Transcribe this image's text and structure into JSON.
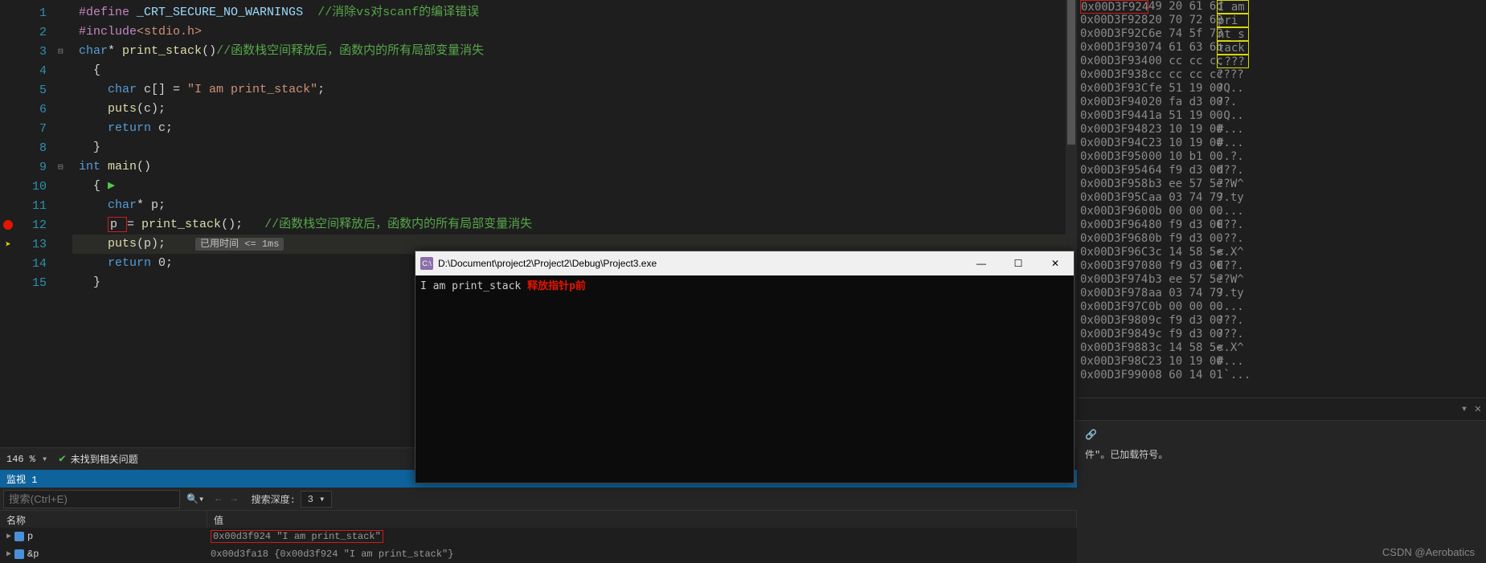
{
  "code": {
    "lines": [
      {
        "n": "1",
        "fold": "",
        "bar": "",
        "bp": "",
        "html": "<span class='define'>#define</span> <span class='macro'>_CRT_SECURE_NO_WARNINGS</span>  <span class='comment'>//消除vs对scanf的编译错误</span>"
      },
      {
        "n": "2",
        "fold": "",
        "bar": "g",
        "bp": "",
        "html": "<span class='define'>#include</span><span class='string'>&lt;stdio.h&gt;</span>"
      },
      {
        "n": "3",
        "fold": "⊟",
        "bar": "g",
        "bp": "",
        "html": "<span class='kw'>char</span><span class='plain'>* </span><span class='ident'>print_stack</span><span class='plain'>()</span><span class='comment'>//函数栈空间释放后，函数内的所有局部变量消失</span>"
      },
      {
        "n": "4",
        "fold": "",
        "bar": "g",
        "bp": "",
        "html": "<span class='plain'>  {</span>"
      },
      {
        "n": "5",
        "fold": "",
        "bar": "g",
        "bp": "",
        "html": "<span class='plain'>    </span><span class='kw'>char</span><span class='plain'> c[] = </span><span class='string'>\"I am print_stack\"</span><span class='plain'>;</span>"
      },
      {
        "n": "6",
        "fold": "",
        "bar": "g",
        "bp": "",
        "html": "<span class='plain'>    </span><span class='ident'>puts</span><span class='plain'>(c);</span>"
      },
      {
        "n": "7",
        "fold": "",
        "bar": "g",
        "bp": "",
        "html": "<span class='plain'>    </span><span class='kw'>return</span><span class='plain'> c;</span>"
      },
      {
        "n": "8",
        "fold": "",
        "bar": "g",
        "bp": "",
        "html": "<span class='plain'>  }</span>"
      },
      {
        "n": "9",
        "fold": "⊟",
        "bar": "g",
        "bp": "",
        "html": "<span class='kw'>int</span><span class='plain'> </span><span class='ident'>main</span><span class='plain'>()</span>"
      },
      {
        "n": "10",
        "fold": "",
        "bar": "g",
        "bp": "",
        "html": "<span class='plain'>  { </span><span style='color:#4ec94e'>▶</span>"
      },
      {
        "n": "11",
        "fold": "",
        "bar": "g",
        "bp": "",
        "html": "<span class='plain'>    </span><span class='kw'>char</span><span class='plain'>* p;</span>"
      },
      {
        "n": "12",
        "fold": "",
        "bar": "g",
        "bp": "bp",
        "html": "<span class='plain'>    </span><span class='red-box'>p </span><span class='plain'>= </span><span class='ident'>print_stack</span><span class='plain'>();   </span><span class='comment'>//函数栈空间释放后，函数内的所有局部变量消失</span>"
      },
      {
        "n": "13",
        "fold": "",
        "bar": "g",
        "bp": "arrow",
        "cls": "current-line",
        "html": "<span class='plain'>    </span><span class='ident'>puts</span><span class='plain'>(p);   </span><span class='timing' data-bind='code.timing'></span>"
      },
      {
        "n": "14",
        "fold": "",
        "bar": "g",
        "bp": "",
        "html": "<span class='plain'>    </span><span class='kw'>return</span><span class='plain'> 0;</span>"
      },
      {
        "n": "15",
        "fold": "",
        "bar": "g",
        "bp": "",
        "html": "<span class='plain'>  }</span>"
      }
    ],
    "timing": "已用时间 <= 1ms"
  },
  "status": {
    "zoom": "146 %",
    "issues": "未找到相关问题"
  },
  "watch": {
    "tab": "监视 1",
    "search_placeholder": "搜索(Ctrl+E)",
    "depth_label": "搜索深度:",
    "depth_value": "3",
    "col_name": "名称",
    "col_value": "值",
    "rows": [
      {
        "name": "p",
        "value_addr": "0x00d3f924",
        "value_str": "\"I am print_stack\"",
        "boxed": true
      },
      {
        "name": "&p",
        "value": "0x00d3fa18 {0x00d3f924 \"I am print_stack\"}",
        "boxed": false
      }
    ]
  },
  "console": {
    "title": "D:\\Document\\project2\\Project2\\Debug\\Project3.exe",
    "output": "I am print_stack",
    "annotation": "释放指针p前"
  },
  "memory": {
    "rows": [
      {
        "addr": "0x00D3F924",
        "hex": "49 20 61 6d",
        "ascii": "I am",
        "addr_boxed": true,
        "ascii_boxed": true
      },
      {
        "addr": "0x00D3F928",
        "hex": "20 70 72 69",
        "ascii": " pri",
        "ascii_boxed": true
      },
      {
        "addr": "0x00D3F92C",
        "hex": "6e 74 5f 73",
        "ascii": "nt_s",
        "ascii_boxed": true
      },
      {
        "addr": "0x00D3F930",
        "hex": "74 61 63 6b",
        "ascii": "tack",
        "ascii_boxed": true
      },
      {
        "addr": "0x00D3F934",
        "hex": "00 cc cc cc",
        "ascii": ".???",
        "ascii_boxed": true
      },
      {
        "addr": "0x00D3F938",
        "hex": "cc cc cc cc",
        "ascii": "????"
      },
      {
        "addr": "0x00D3F93C",
        "hex": "fe 51 19 00",
        "ascii": "?Q.."
      },
      {
        "addr": "0x00D3F940",
        "hex": "20 fa d3 00",
        "ascii": " ??."
      },
      {
        "addr": "0x00D3F944",
        "hex": "1a 51 19 00",
        "ascii": ".Q.."
      },
      {
        "addr": "0x00D3F948",
        "hex": "23 10 19 00",
        "ascii": "#..."
      },
      {
        "addr": "0x00D3F94C",
        "hex": "23 10 19 00",
        "ascii": "#..."
      },
      {
        "addr": "0x00D3F950",
        "hex": "00 10 b1 00",
        "ascii": "..?."
      },
      {
        "addr": "0x00D3F954",
        "hex": "64 f9 d3 00",
        "ascii": "d??."
      },
      {
        "addr": "0x00D3F958",
        "hex": "b3 ee 57 5e",
        "ascii": "??W^"
      },
      {
        "addr": "0x00D3F95C",
        "hex": "aa 03 74 79",
        "ascii": "?.ty"
      },
      {
        "addr": "0x00D3F960",
        "hex": "0b 00 00 00",
        "ascii": "...."
      },
      {
        "addr": "0x00D3F964",
        "hex": "80 f9 d3 00",
        "ascii": "€??."
      },
      {
        "addr": "0x00D3F968",
        "hex": "0b f9 d3 00",
        "ascii": ".??."
      },
      {
        "addr": "0x00D3F96C",
        "hex": "3c 14 58 5e",
        "ascii": "<.X^"
      },
      {
        "addr": "0x00D3F970",
        "hex": "80 f9 d3 00",
        "ascii": "€??."
      },
      {
        "addr": "0x00D3F974",
        "hex": "b3 ee 57 5e",
        "ascii": "??W^"
      },
      {
        "addr": "0x00D3F978",
        "hex": "aa 03 74 79",
        "ascii": "?.ty"
      },
      {
        "addr": "0x00D3F97C",
        "hex": "0b 00 00 00",
        "ascii": "...."
      },
      {
        "addr": "0x00D3F980",
        "hex": "9c f9 d3 00",
        "ascii": "???."
      },
      {
        "addr": "0x00D3F984",
        "hex": "9c f9 d3 00",
        "ascii": "???."
      },
      {
        "addr": "0x00D3F988",
        "hex": "3c 14 58 5e",
        "ascii": "<.X^"
      },
      {
        "addr": "0x00D3F98C",
        "hex": "23 10 19 00",
        "ascii": "#..."
      },
      {
        "addr": "0x00D3F990",
        "hex": "08 60 14 01",
        "ascii": ".`..."
      }
    ]
  },
  "right_bottom": {
    "symbols_text": "件\"。已加载符号。"
  },
  "watermark": "CSDN @Aerobatics"
}
